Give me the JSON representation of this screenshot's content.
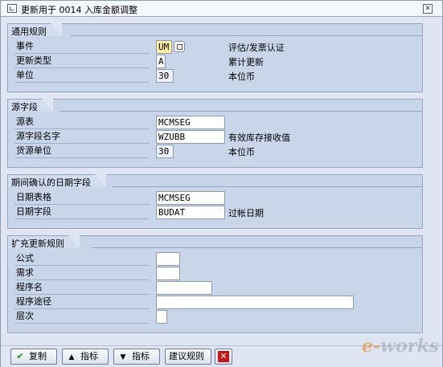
{
  "window": {
    "title": "更新用于 0014 入库金额调整"
  },
  "groups": [
    {
      "title": "通用规则",
      "rows": [
        {
          "label": "事件",
          "value": "UM",
          "desc": "评估/发票认证"
        },
        {
          "label": "更新类型",
          "value": "A",
          "desc": "累计更新"
        },
        {
          "label": "单位",
          "value": "30",
          "desc": "本位币"
        }
      ]
    },
    {
      "title": "源字段",
      "rows": [
        {
          "label": "源表",
          "value": "MCMSEG",
          "desc": ""
        },
        {
          "label": "源字段名字",
          "value": "WZUBB",
          "desc": "有效库存接收值"
        },
        {
          "label": "货源单位",
          "value": "30",
          "desc": "本位币"
        }
      ]
    },
    {
      "title": "期间确认的日期字段",
      "rows": [
        {
          "label": "日期表格",
          "value": "MCMSEG",
          "desc": ""
        },
        {
          "label": "日期字段",
          "value": "BUDAT",
          "desc": "过帐日期"
        }
      ]
    },
    {
      "title": "扩充更新规则",
      "rows": [
        {
          "label": "公式",
          "value": ""
        },
        {
          "label": "需求",
          "value": ""
        },
        {
          "label": "程序名",
          "value": ""
        },
        {
          "label": "程序途径",
          "value": ""
        },
        {
          "label": "层次",
          "value": ""
        }
      ]
    }
  ],
  "toolbar": {
    "copy_label": "复制",
    "up_label": "指标",
    "down_label": "指标",
    "propose_label": "建议规则"
  },
  "watermark": {
    "brand": "works",
    "initial": "e-"
  },
  "colors": {
    "background": "#dfe6f2",
    "group_fill": "#c9d6ea",
    "highlight_field": "#ffef9c",
    "cancel": "#cc1111",
    "confirm": "#1c8a1c"
  },
  "icons": [
    "window-icon",
    "close-icon",
    "f4-help-icon",
    "check-icon",
    "arrow-up-icon",
    "arrow-down-icon",
    "cancel-icon"
  ]
}
